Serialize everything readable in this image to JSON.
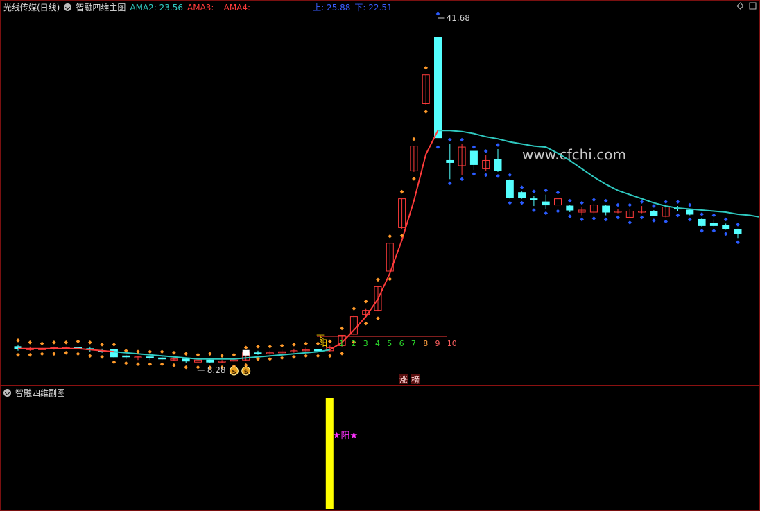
{
  "main_header": {
    "stock_title": "光线传媒(日线)",
    "indicator_name": "智融四维主图",
    "ama2": "AMA2: 23.56",
    "ama3": "AMA3: -",
    "ama4": "AMA4: -",
    "upper": "上: 25.88",
    "lower": "下: 22.51"
  },
  "sub_header": {
    "indicator_name": "智融四维副图"
  },
  "watermark": "www.cfchi.com",
  "annotations": {
    "high_value": "41.68",
    "low_value": "8.28",
    "yang_mark": "阳",
    "down_mark": "下",
    "sub_mark": "★阳★",
    "badge_zhang": "涨",
    "badge_bang": "榜",
    "money_icon_1": "$",
    "money_icon_2": "$"
  },
  "day_counter": [
    "1",
    "2",
    "3",
    "4",
    "5",
    "6",
    "7",
    "8",
    "9",
    "10"
  ],
  "colors": {
    "up": "#ff3b3b",
    "down": "#54ffff",
    "ama_line": "#2fc9c0",
    "dot_upper": "#ff9a2a",
    "dot_blue": "#2a5bff",
    "counter_green": "#2cdc2c",
    "yellow_bar": "#ffff00",
    "magenta": "#ff33ff"
  },
  "chart_data": {
    "type": "candlestick",
    "price_range": [
      8.28,
      41.68
    ],
    "candles": [
      {
        "o": 9.9,
        "c": 9.7,
        "h": 10.1,
        "l": 9.5
      },
      {
        "o": 9.6,
        "c": 9.7,
        "h": 9.9,
        "l": 9.5
      },
      {
        "o": 9.7,
        "c": 9.7,
        "h": 9.8,
        "l": 9.6
      },
      {
        "o": 9.7,
        "c": 9.8,
        "h": 9.9,
        "l": 9.6
      },
      {
        "o": 9.8,
        "c": 9.8,
        "h": 9.9,
        "l": 9.7
      },
      {
        "o": 9.8,
        "c": 9.7,
        "h": 10.0,
        "l": 9.6
      },
      {
        "o": 9.7,
        "c": 9.6,
        "h": 9.9,
        "l": 9.4
      },
      {
        "o": 9.5,
        "c": 9.4,
        "h": 9.7,
        "l": 9.3
      },
      {
        "o": 9.6,
        "c": 8.9,
        "h": 9.7,
        "l": 8.8
      },
      {
        "o": 9.0,
        "c": 8.9,
        "h": 9.1,
        "l": 8.7
      },
      {
        "o": 8.8,
        "c": 8.9,
        "h": 9.0,
        "l": 8.6
      },
      {
        "o": 8.9,
        "c": 8.8,
        "h": 9.0,
        "l": 8.6
      },
      {
        "o": 8.8,
        "c": 8.7,
        "h": 9.0,
        "l": 8.6
      },
      {
        "o": 8.7,
        "c": 8.7,
        "h": 8.9,
        "l": 8.5
      },
      {
        "o": 8.7,
        "c": 8.5,
        "h": 8.8,
        "l": 8.3
      },
      {
        "o": 8.4,
        "c": 8.6,
        "h": 8.7,
        "l": 8.3
      },
      {
        "o": 8.6,
        "c": 8.4,
        "h": 8.8,
        "l": 8.28
      },
      {
        "o": 8.4,
        "c": 8.5,
        "h": 8.6,
        "l": 8.3
      },
      {
        "o": 8.5,
        "c": 8.6,
        "h": 8.7,
        "l": 8.4
      },
      {
        "o": 8.6,
        "c": 9.3,
        "h": 9.4,
        "l": 8.5
      },
      {
        "o": 9.3,
        "c": 9.2,
        "h": 9.5,
        "l": 9.1
      },
      {
        "o": 9.2,
        "c": 9.3,
        "h": 9.5,
        "l": 9.1
      },
      {
        "o": 9.3,
        "c": 9.4,
        "h": 9.6,
        "l": 9.2
      },
      {
        "o": 9.4,
        "c": 9.5,
        "h": 9.7,
        "l": 9.3
      },
      {
        "o": 9.5,
        "c": 9.6,
        "h": 9.8,
        "l": 9.4
      },
      {
        "o": 9.6,
        "c": 9.5,
        "h": 9.8,
        "l": 9.4
      },
      {
        "o": 9.5,
        "c": 9.8,
        "h": 10.0,
        "l": 9.4
      },
      {
        "o": 10.0,
        "c": 11.0,
        "h": 11.0,
        "l": 9.9
      },
      {
        "o": 11.1,
        "c": 12.8,
        "h": 12.9,
        "l": 11.0
      },
      {
        "o": 13.0,
        "c": 13.4,
        "h": 13.6,
        "l": 12.8
      },
      {
        "o": 13.4,
        "c": 15.7,
        "h": 15.7,
        "l": 13.3
      },
      {
        "o": 17.2,
        "c": 19.9,
        "h": 19.9,
        "l": 17.1
      },
      {
        "o": 21.4,
        "c": 24.2,
        "h": 24.2,
        "l": 21.3
      },
      {
        "o": 26.9,
        "c": 29.3,
        "h": 29.3,
        "l": 26.8
      },
      {
        "o": 33.4,
        "c": 36.2,
        "h": 36.2,
        "l": 33.3
      },
      {
        "o": 39.8,
        "c": 30.1,
        "h": 41.68,
        "l": 29.6
      },
      {
        "o": 27.9,
        "c": 27.7,
        "h": 29.5,
        "l": 26.1
      },
      {
        "o": 27.4,
        "c": 29.2,
        "h": 29.5,
        "l": 26.5
      },
      {
        "o": 28.8,
        "c": 27.5,
        "h": 28.8,
        "l": 27.0
      },
      {
        "o": 27.1,
        "c": 27.9,
        "h": 28.4,
        "l": 26.9
      },
      {
        "o": 28.0,
        "c": 26.9,
        "h": 29.0,
        "l": 26.8
      },
      {
        "o": 26.0,
        "c": 24.3,
        "h": 26.1,
        "l": 24.2
      },
      {
        "o": 24.8,
        "c": 24.3,
        "h": 24.9,
        "l": 24.2
      },
      {
        "o": 24.2,
        "c": 24.1,
        "h": 24.5,
        "l": 23.5
      },
      {
        "o": 23.9,
        "c": 23.6,
        "h": 24.6,
        "l": 23.2
      },
      {
        "o": 23.6,
        "c": 24.2,
        "h": 24.4,
        "l": 23.4
      },
      {
        "o": 23.5,
        "c": 23.1,
        "h": 23.6,
        "l": 22.9
      },
      {
        "o": 22.9,
        "c": 23.1,
        "h": 23.4,
        "l": 22.6
      },
      {
        "o": 22.9,
        "c": 23.6,
        "h": 23.7,
        "l": 22.7
      },
      {
        "o": 23.5,
        "c": 22.9,
        "h": 23.6,
        "l": 22.6
      },
      {
        "o": 22.9,
        "c": 23.0,
        "h": 23.2,
        "l": 22.8
      },
      {
        "o": 22.4,
        "c": 23.0,
        "h": 23.2,
        "l": 22.3
      },
      {
        "o": 22.9,
        "c": 23.0,
        "h": 23.5,
        "l": 22.8
      },
      {
        "o": 23.0,
        "c": 22.6,
        "h": 23.1,
        "l": 22.5
      },
      {
        "o": 22.5,
        "c": 23.4,
        "h": 23.5,
        "l": 22.4
      },
      {
        "o": 23.3,
        "c": 23.2,
        "h": 23.5,
        "l": 23.0
      },
      {
        "o": 23.1,
        "c": 22.7,
        "h": 23.2,
        "l": 22.6
      },
      {
        "o": 22.2,
        "c": 21.6,
        "h": 22.3,
        "l": 21.5
      },
      {
        "o": 21.8,
        "c": 21.6,
        "h": 22.2,
        "l": 21.5
      },
      {
        "o": 21.6,
        "c": 21.3,
        "h": 21.8,
        "l": 21.2
      },
      {
        "o": 21.2,
        "c": 20.8,
        "h": 21.3,
        "l": 20.4
      }
    ],
    "ama_line": [
      9.7,
      9.7,
      9.7,
      9.7,
      9.7,
      9.7,
      9.6,
      9.5,
      9.4,
      9.3,
      9.2,
      9.1,
      9.0,
      8.9,
      8.8,
      8.7,
      8.7,
      8.7,
      8.7,
      8.8,
      8.9,
      9.0,
      9.1,
      9.2,
      9.3,
      9.4,
      9.6,
      10.3,
      11.5,
      12.8,
      14.5,
      17.0,
      20.2,
      24.0,
      28.5,
      30.8,
      30.8,
      30.7,
      30.5,
      30.2,
      30.0,
      29.7,
      29.5,
      29.3,
      29.2,
      28.6,
      27.9,
      27.1,
      26.3,
      25.6,
      25.0,
      24.6,
      24.2,
      23.8,
      23.5,
      23.3,
      23.2,
      23.1,
      23.0,
      22.9,
      22.7,
      22.6,
      22.4
    ],
    "sub_bar": {
      "index": 26,
      "value": 1,
      "label": "★阳★"
    }
  }
}
